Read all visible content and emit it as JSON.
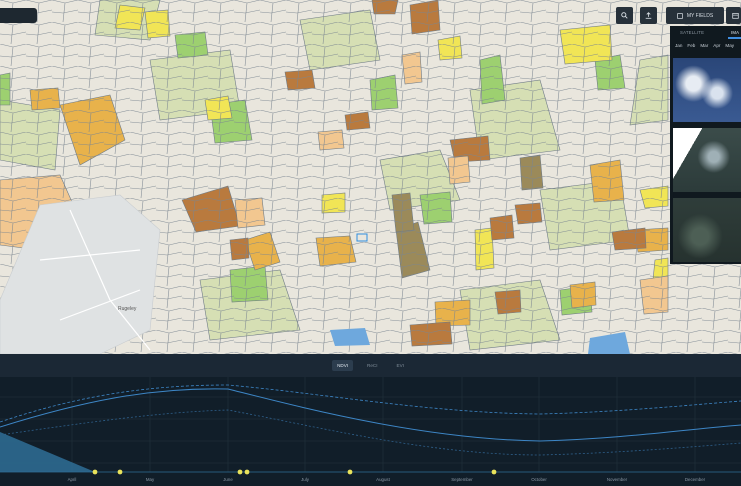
{
  "toolbar": {
    "search_icon": "search-icon",
    "upload_icon": "upload-icon",
    "my_fields_label": "MY FIELDS",
    "calendar_icon": "calendar-icon"
  },
  "side_panel": {
    "tabs": [
      "SATELLITE",
      "IMA"
    ],
    "months": [
      "Jan",
      "Feb",
      "Mar",
      "Apr",
      "May"
    ]
  },
  "map": {
    "place_labels": [
      "Rugeley"
    ]
  },
  "index_bar": {
    "items": [
      "NDVI",
      "ReCI",
      "EVI"
    ],
    "active": "NDVI"
  },
  "timeline": {
    "month_labels": [
      "April",
      "May",
      "June",
      "July",
      "August",
      "September",
      "October",
      "November",
      "December"
    ],
    "observation_count": 7
  },
  "colors": {
    "map_base": "#e9e6dd",
    "field_outline": "#6f7b86",
    "panel_bg": "#10191f",
    "chart_bg": "#111e29",
    "curve": "#3d86c6",
    "marker": "#e9e35b"
  }
}
